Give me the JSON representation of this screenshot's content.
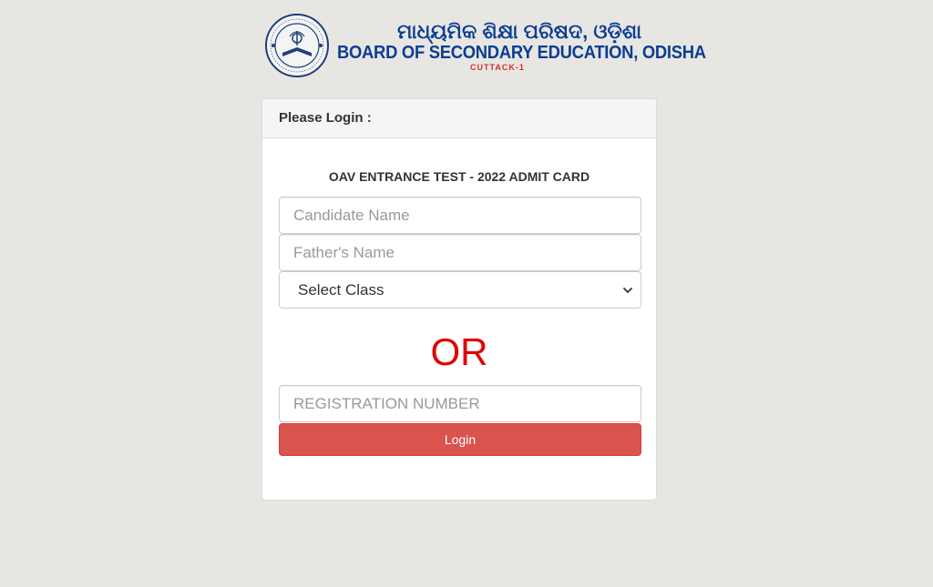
{
  "header": {
    "title_odia": "ମାଧ୍ୟମିକ ଶିକ୍ଷା ପରିଷଦ, ଓଡ଼ିଶା",
    "title_en": "BOARD OF SECONDARY EDUCATION, ODISHA",
    "city": "CUTTACK-1",
    "logo_ring_top": "BOARD OF SECONDARY EDUCATION",
    "logo_ring_bottom": "ORISSA"
  },
  "panel": {
    "heading": "Please Login :",
    "form_title": "OAV ENTRANCE TEST - 2022 ADMIT CARD",
    "candidate_name_placeholder": "Candidate Name",
    "father_name_placeholder": "Father's Name",
    "class_select_value": "Select Class",
    "or_text": "OR",
    "registration_placeholder": "REGISTRATION NUMBER",
    "login_label": "Login"
  },
  "colors": {
    "brand_blue": "#0b3d91",
    "accent_red": "#e00000",
    "button_red": "#d9534f"
  }
}
